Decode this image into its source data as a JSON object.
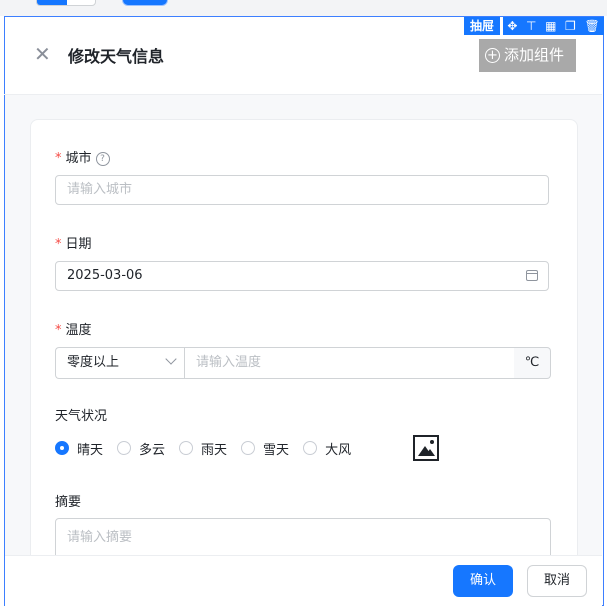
{
  "drawer": {
    "tag": "抽屉",
    "tool_icons": [
      "move-icon",
      "align-top-icon",
      "table-icon",
      "copy-icon",
      "delete-icon"
    ],
    "title": "修改天气信息",
    "add_component_label": "添加组件"
  },
  "form": {
    "city": {
      "label": "城市",
      "placeholder": "请输入城市",
      "required": true
    },
    "date": {
      "label": "日期",
      "value": "2025-03-06",
      "required": true
    },
    "temperature": {
      "label": "温度",
      "select_value": "零度以上",
      "placeholder": "请输入温度",
      "unit": "℃",
      "required": true
    },
    "weather": {
      "label": "天气状况",
      "options": [
        "晴天",
        "多云",
        "雨天",
        "雪天",
        "大风"
      ],
      "selected": "晴天"
    },
    "summary": {
      "label": "摘要",
      "placeholder": "请输入摘要"
    }
  },
  "footer": {
    "confirm_label": "确认",
    "cancel_label": "取消"
  },
  "colors": {
    "accent": "#1677ff",
    "required": "#f54a45"
  }
}
